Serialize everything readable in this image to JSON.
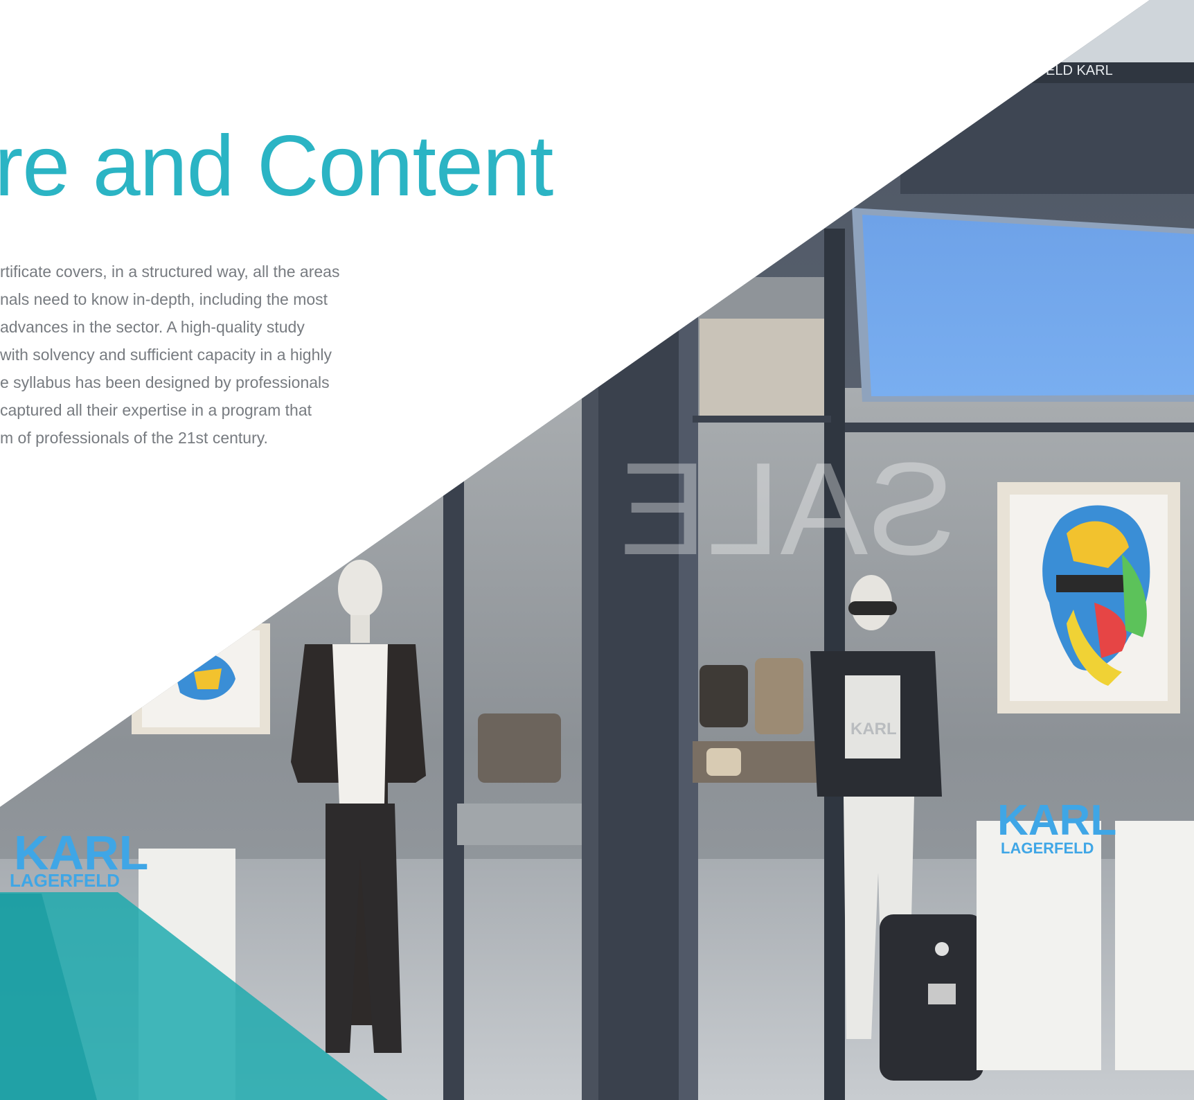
{
  "page": {
    "heading": "re and Content",
    "body_lines": [
      "rtificate covers, in a structured way, all the areas",
      "nals need to know in-depth, including the most",
      "advances in the sector. A high-quality study",
      "with solvency and sufficient capacity in a highly",
      "e syllabus has been designed by professionals",
      " captured all their expertise in a program that",
      "m of professionals of the 21st century."
    ]
  },
  "photo": {
    "subject": "storefront-window-photo",
    "sign_left_brand": "KARL",
    "sign_left_sub": "LAGERFELD",
    "sign_right_brand": "KARL",
    "sign_right_sub": "LAGERFELD",
    "shirt_text": "KARL",
    "top_sign_text": "ELD KARL",
    "reflection_text": "SALE"
  },
  "colors": {
    "accent": "#2bb4c4",
    "text": "#777b80",
    "teal_overlay": "#1aa9ad"
  }
}
